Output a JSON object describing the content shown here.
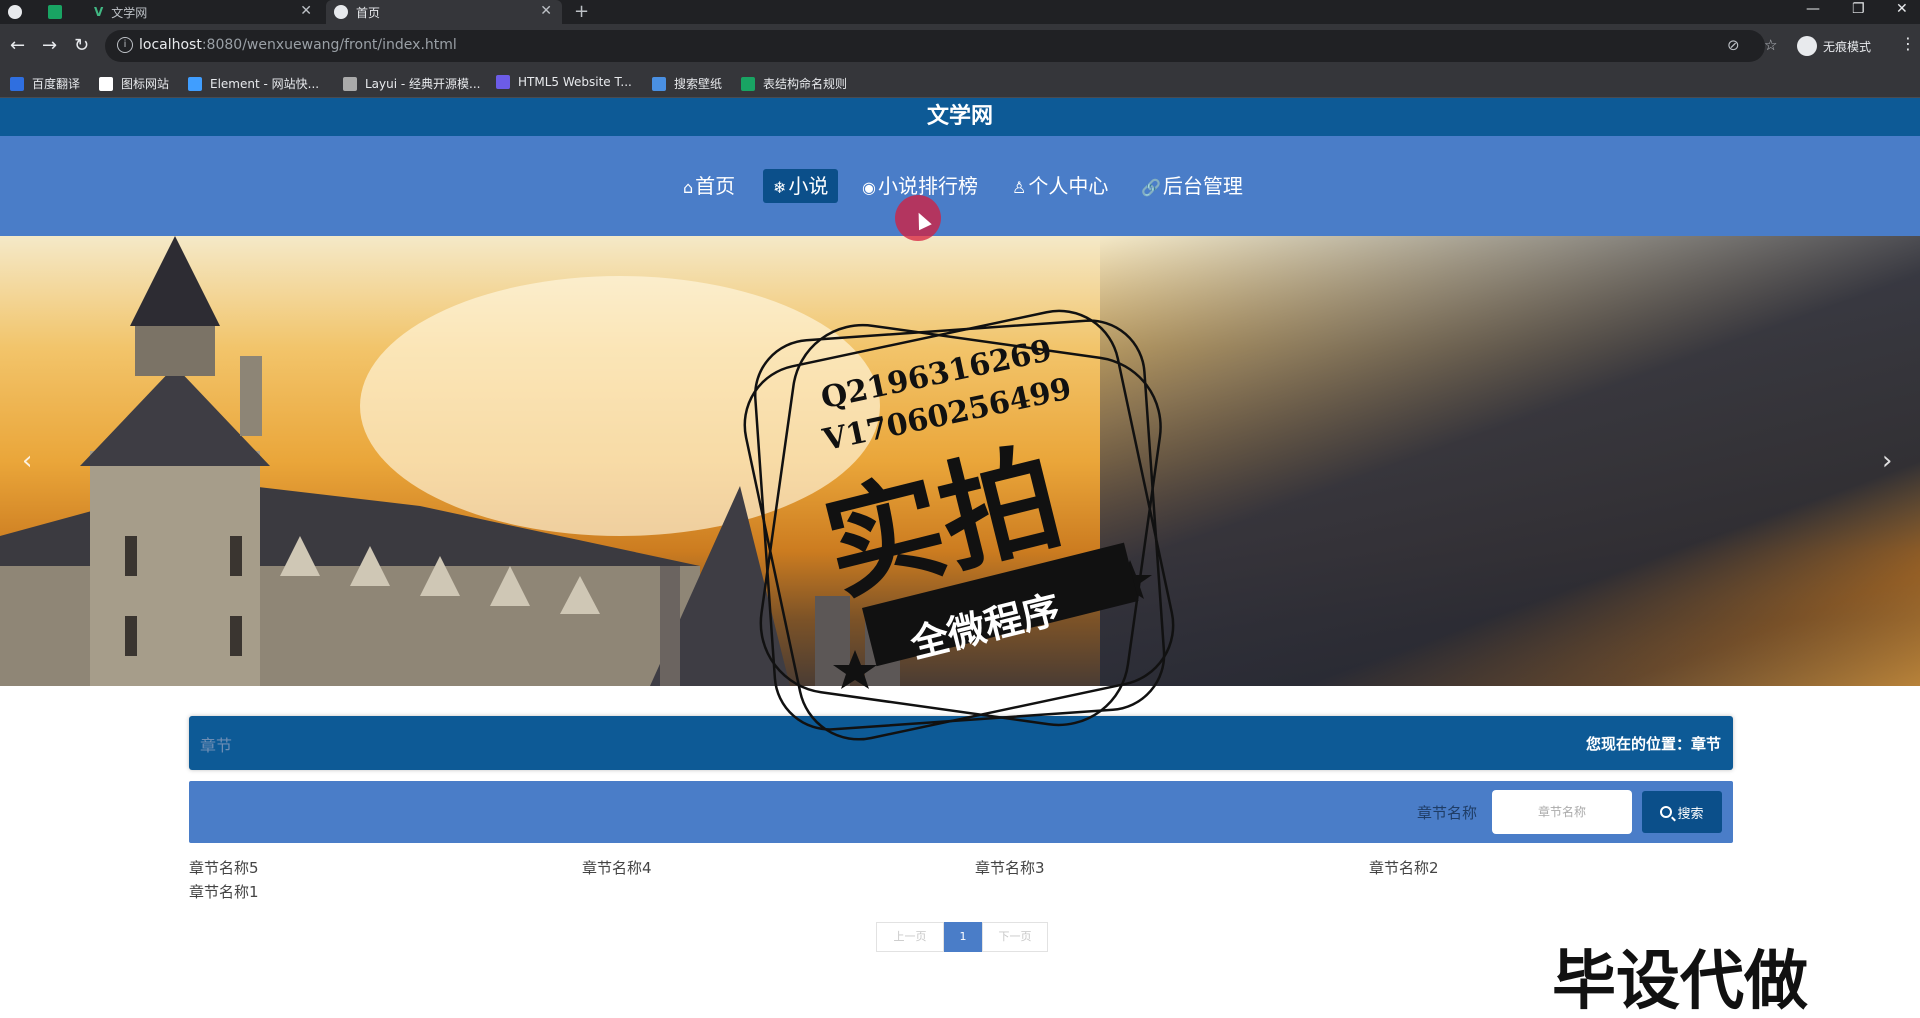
{
  "browser": {
    "tabs": [
      {
        "title": ""
      },
      {
        "title": ""
      },
      {
        "title": "文学网"
      },
      {
        "title": "首页"
      }
    ],
    "url_host": "localhost",
    "url_rest": ":8080/wenxuewang/front/index.html",
    "profile_label": "无痕模式",
    "bookmarks": [
      {
        "label": "百度翻译",
        "color": "#2f6fe0"
      },
      {
        "label": "图标网站",
        "color": "#ffffff"
      },
      {
        "label": "Element - 网站快...",
        "color": "#409eff"
      },
      {
        "label": "Layui - 经典开源模...",
        "color": "#aaaaaa"
      },
      {
        "label": "HTML5 Website T...",
        "color": "#6c5ce7"
      },
      {
        "label": "搜索壁纸",
        "color": "#4a90e2"
      },
      {
        "label": "表结构命名规则",
        "color": "#19a463"
      }
    ]
  },
  "site": {
    "title": "文学网",
    "nav": [
      {
        "label": "首页",
        "icon": "home-icon"
      },
      {
        "label": "小说",
        "icon": "snowflake-icon",
        "active": true
      },
      {
        "label": "小说排行榜",
        "icon": "globe-icon"
      },
      {
        "label": "个人中心",
        "icon": "user-icon"
      },
      {
        "label": "后台管理",
        "icon": "link-icon"
      }
    ]
  },
  "watermark": {
    "line1": "Q2196316269",
    "line2": "V17060256499",
    "big": "实拍",
    "ribbon": "全微程序",
    "corner": "毕设代做"
  },
  "section": {
    "title": "章节",
    "breadcrumb": "您现在的位置：章节"
  },
  "search": {
    "label": "章节名称",
    "placeholder": "章节名称",
    "button": "搜索"
  },
  "chapters": [
    "章节名称5",
    "章节名称4",
    "章节名称3",
    "章节名称2",
    "章节名称1"
  ],
  "pagination": {
    "prev": "上一页",
    "current": "1",
    "next": "下一页"
  },
  "colors": {
    "header_dark": "#0d5a96",
    "nav_blue": "#4a7dc8",
    "active_tab": "#0b4f8a"
  }
}
